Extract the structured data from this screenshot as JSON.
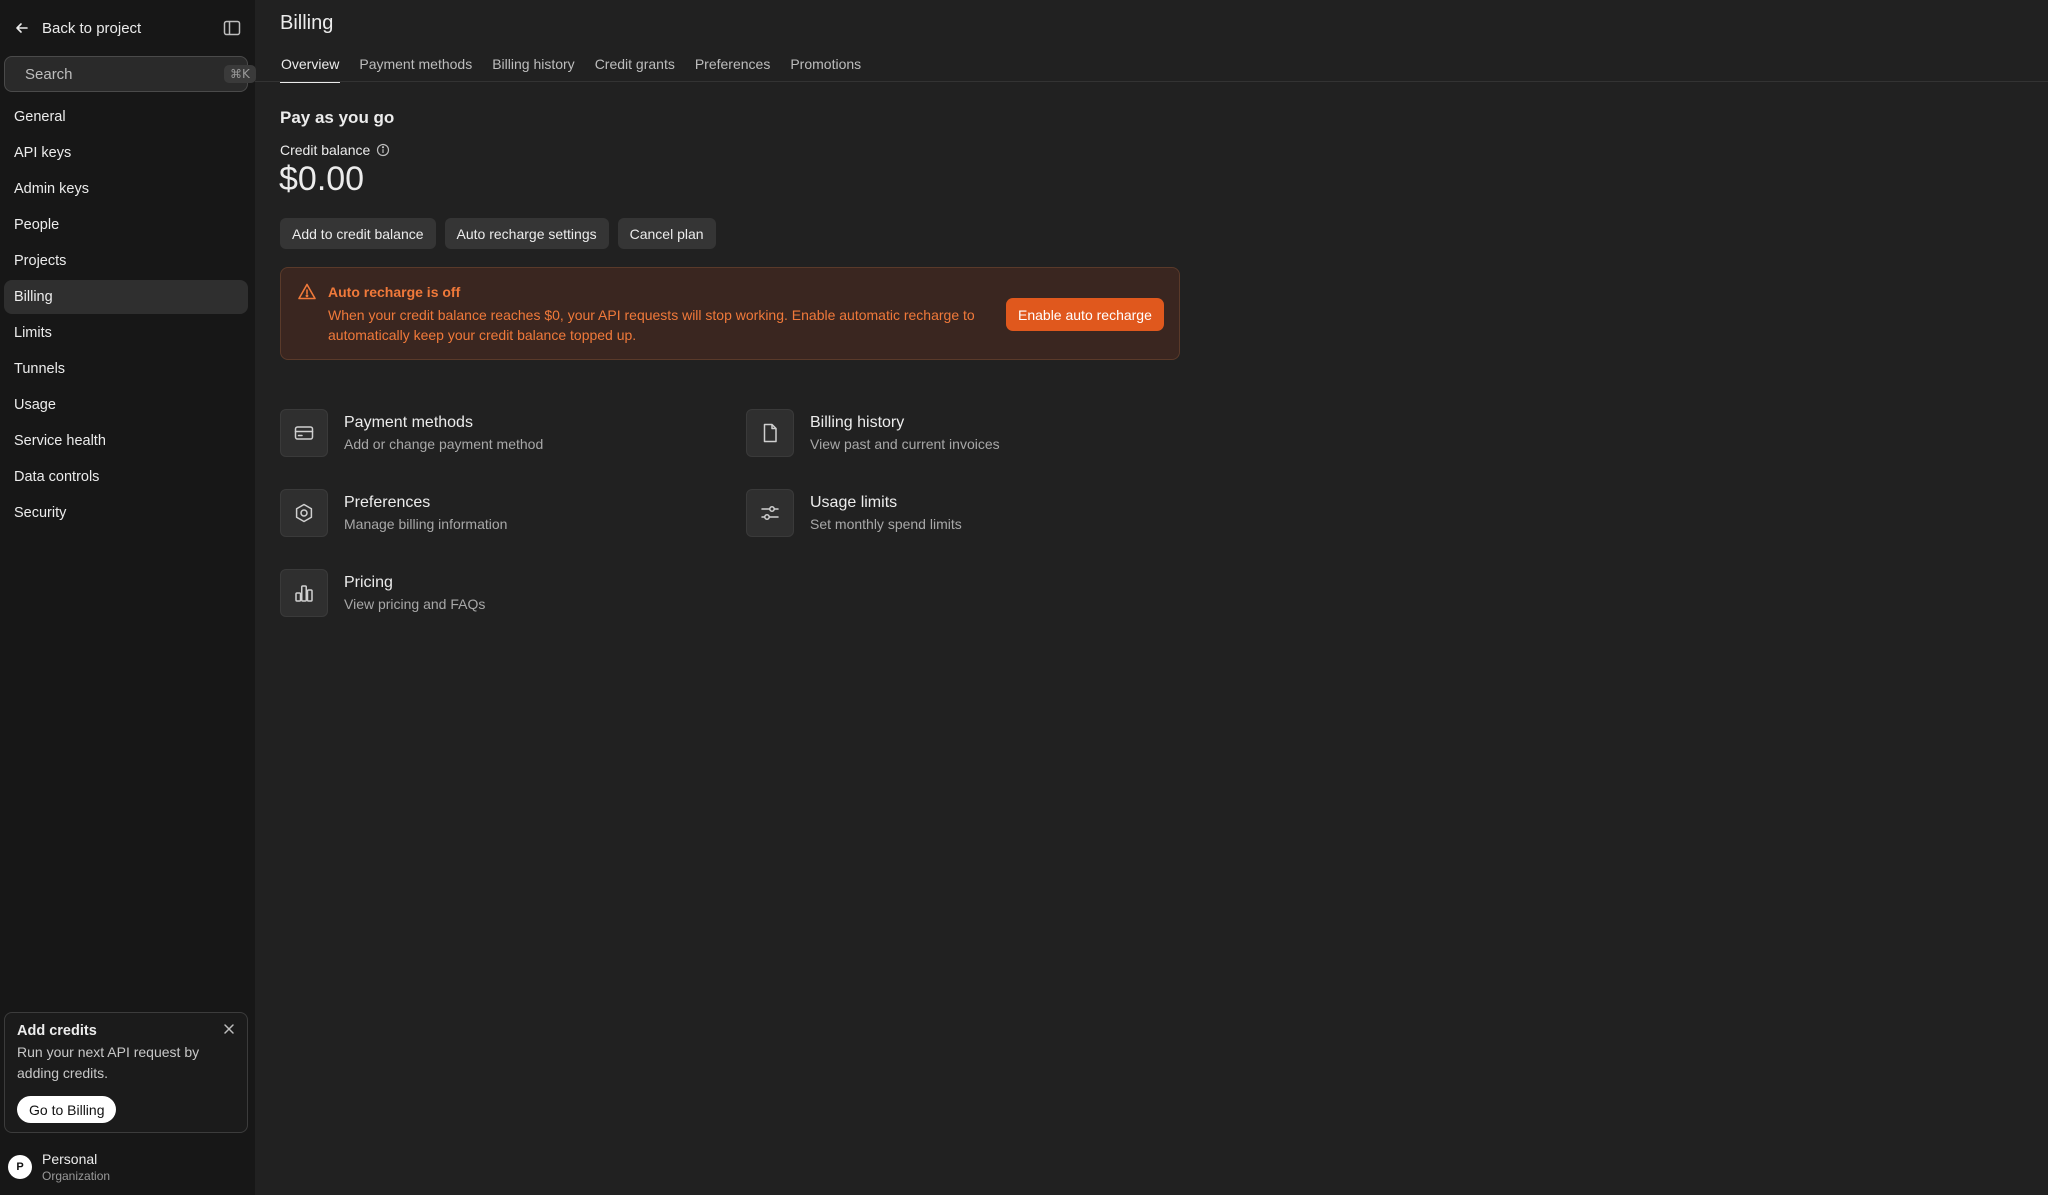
{
  "sidebar": {
    "back_label": "Back to project",
    "search_placeholder": "Search",
    "search_shortcut": "⌘K",
    "items": [
      {
        "label": "General"
      },
      {
        "label": "API keys"
      },
      {
        "label": "Admin keys"
      },
      {
        "label": "People"
      },
      {
        "label": "Projects"
      },
      {
        "label": "Billing",
        "active": true
      },
      {
        "label": "Limits"
      },
      {
        "label": "Tunnels"
      },
      {
        "label": "Usage"
      },
      {
        "label": "Service health"
      },
      {
        "label": "Data controls"
      },
      {
        "label": "Security"
      }
    ],
    "credits_card": {
      "title": "Add credits",
      "text": "Run your next API request by adding credits.",
      "button": "Go to Billing"
    },
    "org": {
      "initial": "P",
      "name": "Personal",
      "type": "Organization"
    }
  },
  "header": {
    "title": "Billing",
    "tabs": [
      {
        "label": "Overview",
        "active": true
      },
      {
        "label": "Payment methods"
      },
      {
        "label": "Billing history"
      },
      {
        "label": "Credit grants"
      },
      {
        "label": "Preferences"
      },
      {
        "label": "Promotions"
      }
    ]
  },
  "overview": {
    "section_title": "Pay as you go",
    "credit_label": "Credit balance",
    "credit_amount": "$0.00",
    "actions": {
      "add_credit": "Add to credit balance",
      "auto_recharge": "Auto recharge settings",
      "cancel": "Cancel plan"
    },
    "alert": {
      "title": "Auto recharge is off",
      "text": "When your credit balance reaches $0, your API requests will stop working. Enable automatic recharge to automatically keep your credit balance topped up.",
      "button": "Enable auto recharge"
    },
    "cards": {
      "payment_methods": {
        "title": "Payment methods",
        "sub": "Add or change payment method"
      },
      "billing_history": {
        "title": "Billing history",
        "sub": "View past and current invoices"
      },
      "preferences": {
        "title": "Preferences",
        "sub": "Manage billing information"
      },
      "usage_limits": {
        "title": "Usage limits",
        "sub": "Set monthly spend limits"
      },
      "pricing": {
        "title": "Pricing",
        "sub": "View pricing and FAQs"
      }
    }
  },
  "colors": {
    "background": "#212121",
    "sidebar": "#171717",
    "accent": "#e0581d",
    "warning_text": "#f0793a"
  },
  "icons": {
    "back": "arrow-left-icon",
    "panel": "sidebar-toggle-icon",
    "search": "search-icon",
    "info": "info-icon",
    "warning": "warning-triangle-icon",
    "close": "close-icon"
  }
}
